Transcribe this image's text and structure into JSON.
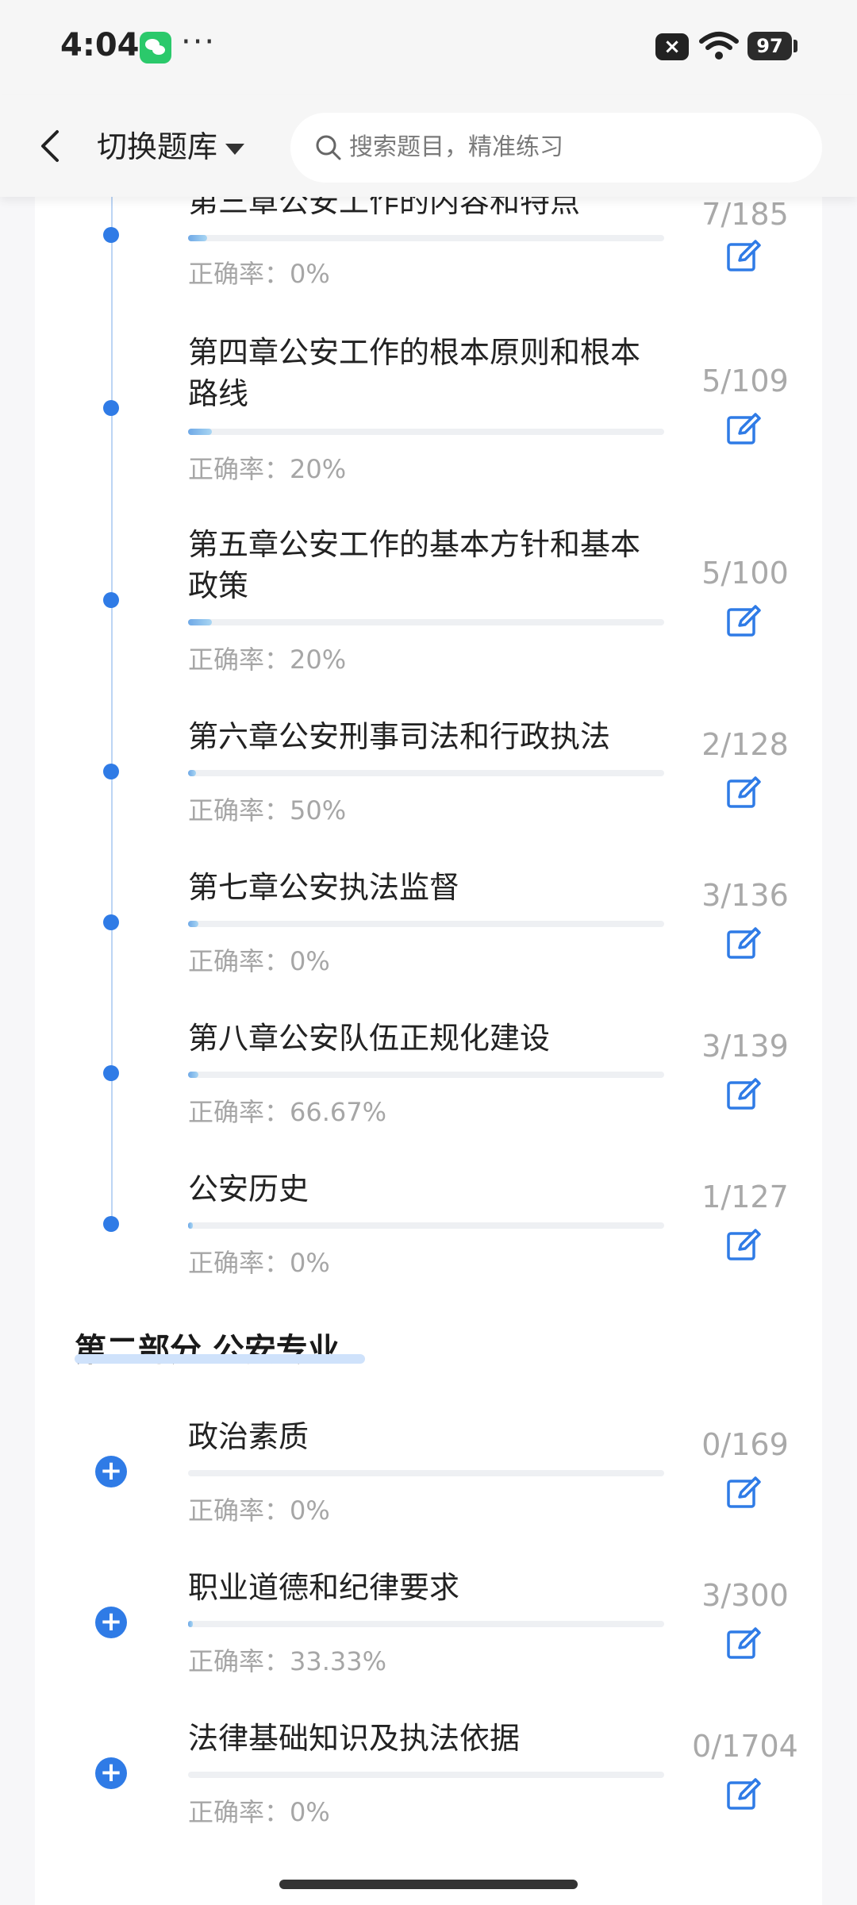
{
  "status": {
    "time": "4:04",
    "battery": "97",
    "dots": "···"
  },
  "header": {
    "switch_label": "切换题库",
    "search_placeholder": "搜索题目，精准练习"
  },
  "chapters": [
    {
      "title": "第三章公安工作的内容和特点",
      "rate": "正确率：0%",
      "count": "7/185",
      "progress": 0.04
    },
    {
      "title": "第四章公安工作的根本原则和根本路线",
      "rate": "正确率：20%",
      "count": "5/109",
      "progress": 0.05
    },
    {
      "title": "第五章公安工作的基本方针和基本政策",
      "rate": "正确率：20%",
      "count": "5/100",
      "progress": 0.05
    },
    {
      "title": "第六章公安刑事司法和行政执法",
      "rate": "正确率：50%",
      "count": "2/128",
      "progress": 0.016
    },
    {
      "title": "第七章公安执法监督",
      "rate": "正确率：0%",
      "count": "3/136",
      "progress": 0.022
    },
    {
      "title": "第八章公安队伍正规化建设",
      "rate": "正确率：66.67%",
      "count": "3/139",
      "progress": 0.022
    },
    {
      "title": "公安历史",
      "rate": "正确率：0%",
      "count": "1/127",
      "progress": 0.008
    }
  ],
  "section2": {
    "title": "第二部分 公安专业"
  },
  "section2_items": [
    {
      "title": "政治素质",
      "rate": "正确率：0%",
      "count": "0/169",
      "progress": 0
    },
    {
      "title": "职业道德和纪律要求",
      "rate": "正确率：33.33%",
      "count": "3/300",
      "progress": 0.01
    },
    {
      "title": "法律基础知识及执法依据",
      "rate": "正确率：0%",
      "count": "0/1704",
      "progress": 0
    }
  ],
  "colors": {
    "accent": "#2f7be6",
    "timeline": "#bcd5f4"
  }
}
